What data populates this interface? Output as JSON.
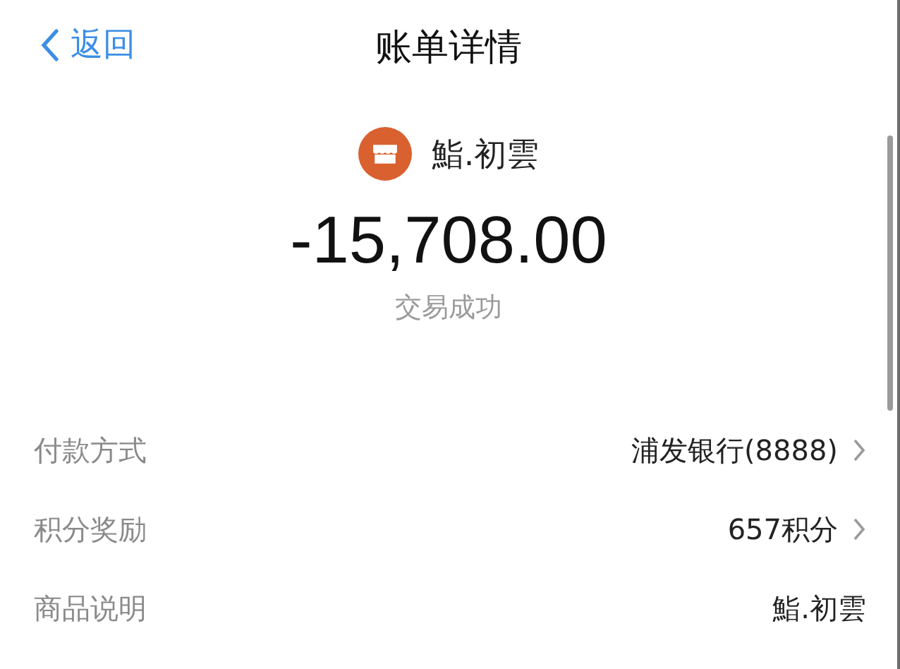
{
  "nav": {
    "back": "返回",
    "title": "账单详情"
  },
  "merchant": {
    "name": "鮨.初雲"
  },
  "amount": "-15,708.00",
  "status": "交易成功",
  "details": [
    {
      "label": "付款方式",
      "value": "浦发银行(8888)",
      "arrow": true
    },
    {
      "label": "积分奖励",
      "value": "657积分",
      "arrow": true
    },
    {
      "label": "商品说明",
      "value": "鮨.初雲",
      "arrow": false
    }
  ]
}
